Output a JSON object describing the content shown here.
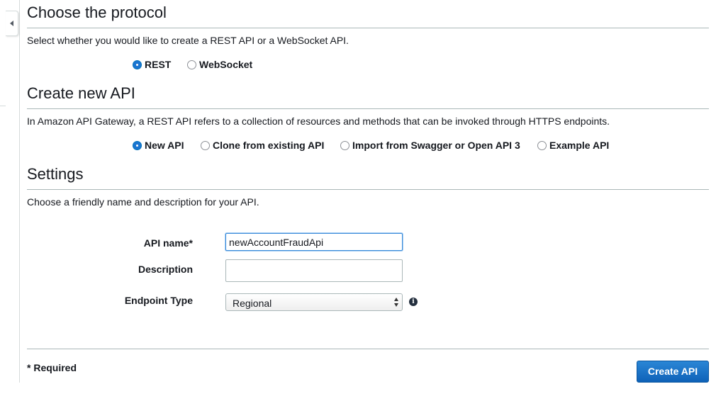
{
  "protocol": {
    "title": "Choose the protocol",
    "description": "Select whether you would like to create a REST API or a WebSocket API.",
    "options": [
      {
        "label": "REST",
        "selected": true
      },
      {
        "label": "WebSocket",
        "selected": false
      }
    ]
  },
  "create_api": {
    "title": "Create new API",
    "description": "In Amazon API Gateway, a REST API refers to a collection of resources and methods that can be invoked through HTTPS endpoints.",
    "options": [
      {
        "label": "New API",
        "selected": true
      },
      {
        "label": "Clone from existing API",
        "selected": false
      },
      {
        "label": "Import from Swagger or Open API 3",
        "selected": false
      },
      {
        "label": "Example API",
        "selected": false
      }
    ]
  },
  "settings": {
    "title": "Settings",
    "description": "Choose a friendly name and description for your API.",
    "fields": {
      "api_name": {
        "label": "API name*",
        "value": "newAccountFraudApi",
        "placeholder": ""
      },
      "description": {
        "label": "Description",
        "value": "",
        "placeholder": ""
      },
      "endpoint_type": {
        "label": "Endpoint Type",
        "selected": "Regional",
        "info_icon": "info-icon"
      }
    }
  },
  "footer": {
    "required_note": "* Required",
    "create_label": "Create API"
  },
  "colors": {
    "accent": "#1a75d1",
    "button": "#1566c0"
  }
}
